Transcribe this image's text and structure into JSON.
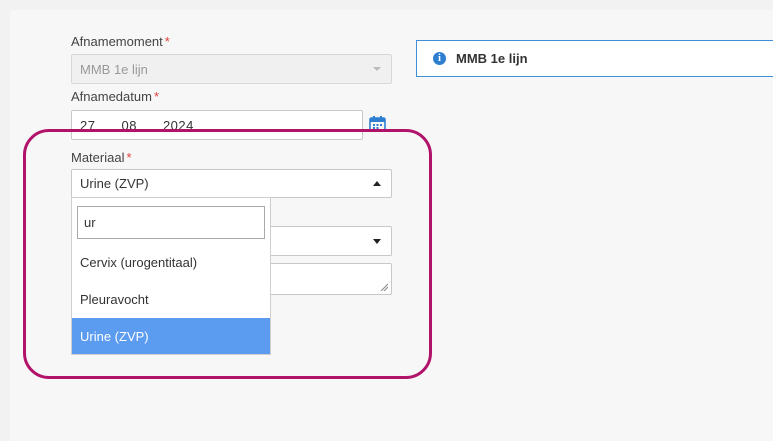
{
  "form": {
    "afnamemoment": {
      "label": "Afnamemoment",
      "required_marker": "*",
      "value": "MMB 1e lijn"
    },
    "afnamedatum": {
      "label": "Afnamedatum",
      "required_marker": "*",
      "day": "27",
      "month": "08",
      "year": "2024"
    },
    "materiaal": {
      "label": "Materiaal",
      "required_marker": "*",
      "value": "Urine (ZVP)",
      "dropdown_open": true,
      "search_value": "ur",
      "options": [
        {
          "label": "Cervix (urogentitaal)",
          "selected": false
        },
        {
          "label": "Pleuravocht",
          "selected": false
        },
        {
          "label": "Urine (ZVP)",
          "selected": true
        }
      ]
    }
  },
  "info_box": {
    "text": "MMB 1e lijn",
    "icon": "info-icon"
  },
  "colors": {
    "highlight": "#b2136a",
    "selected_option": "#5b9bf0",
    "info_border": "#3f8fd8",
    "required": "#e0413b"
  }
}
